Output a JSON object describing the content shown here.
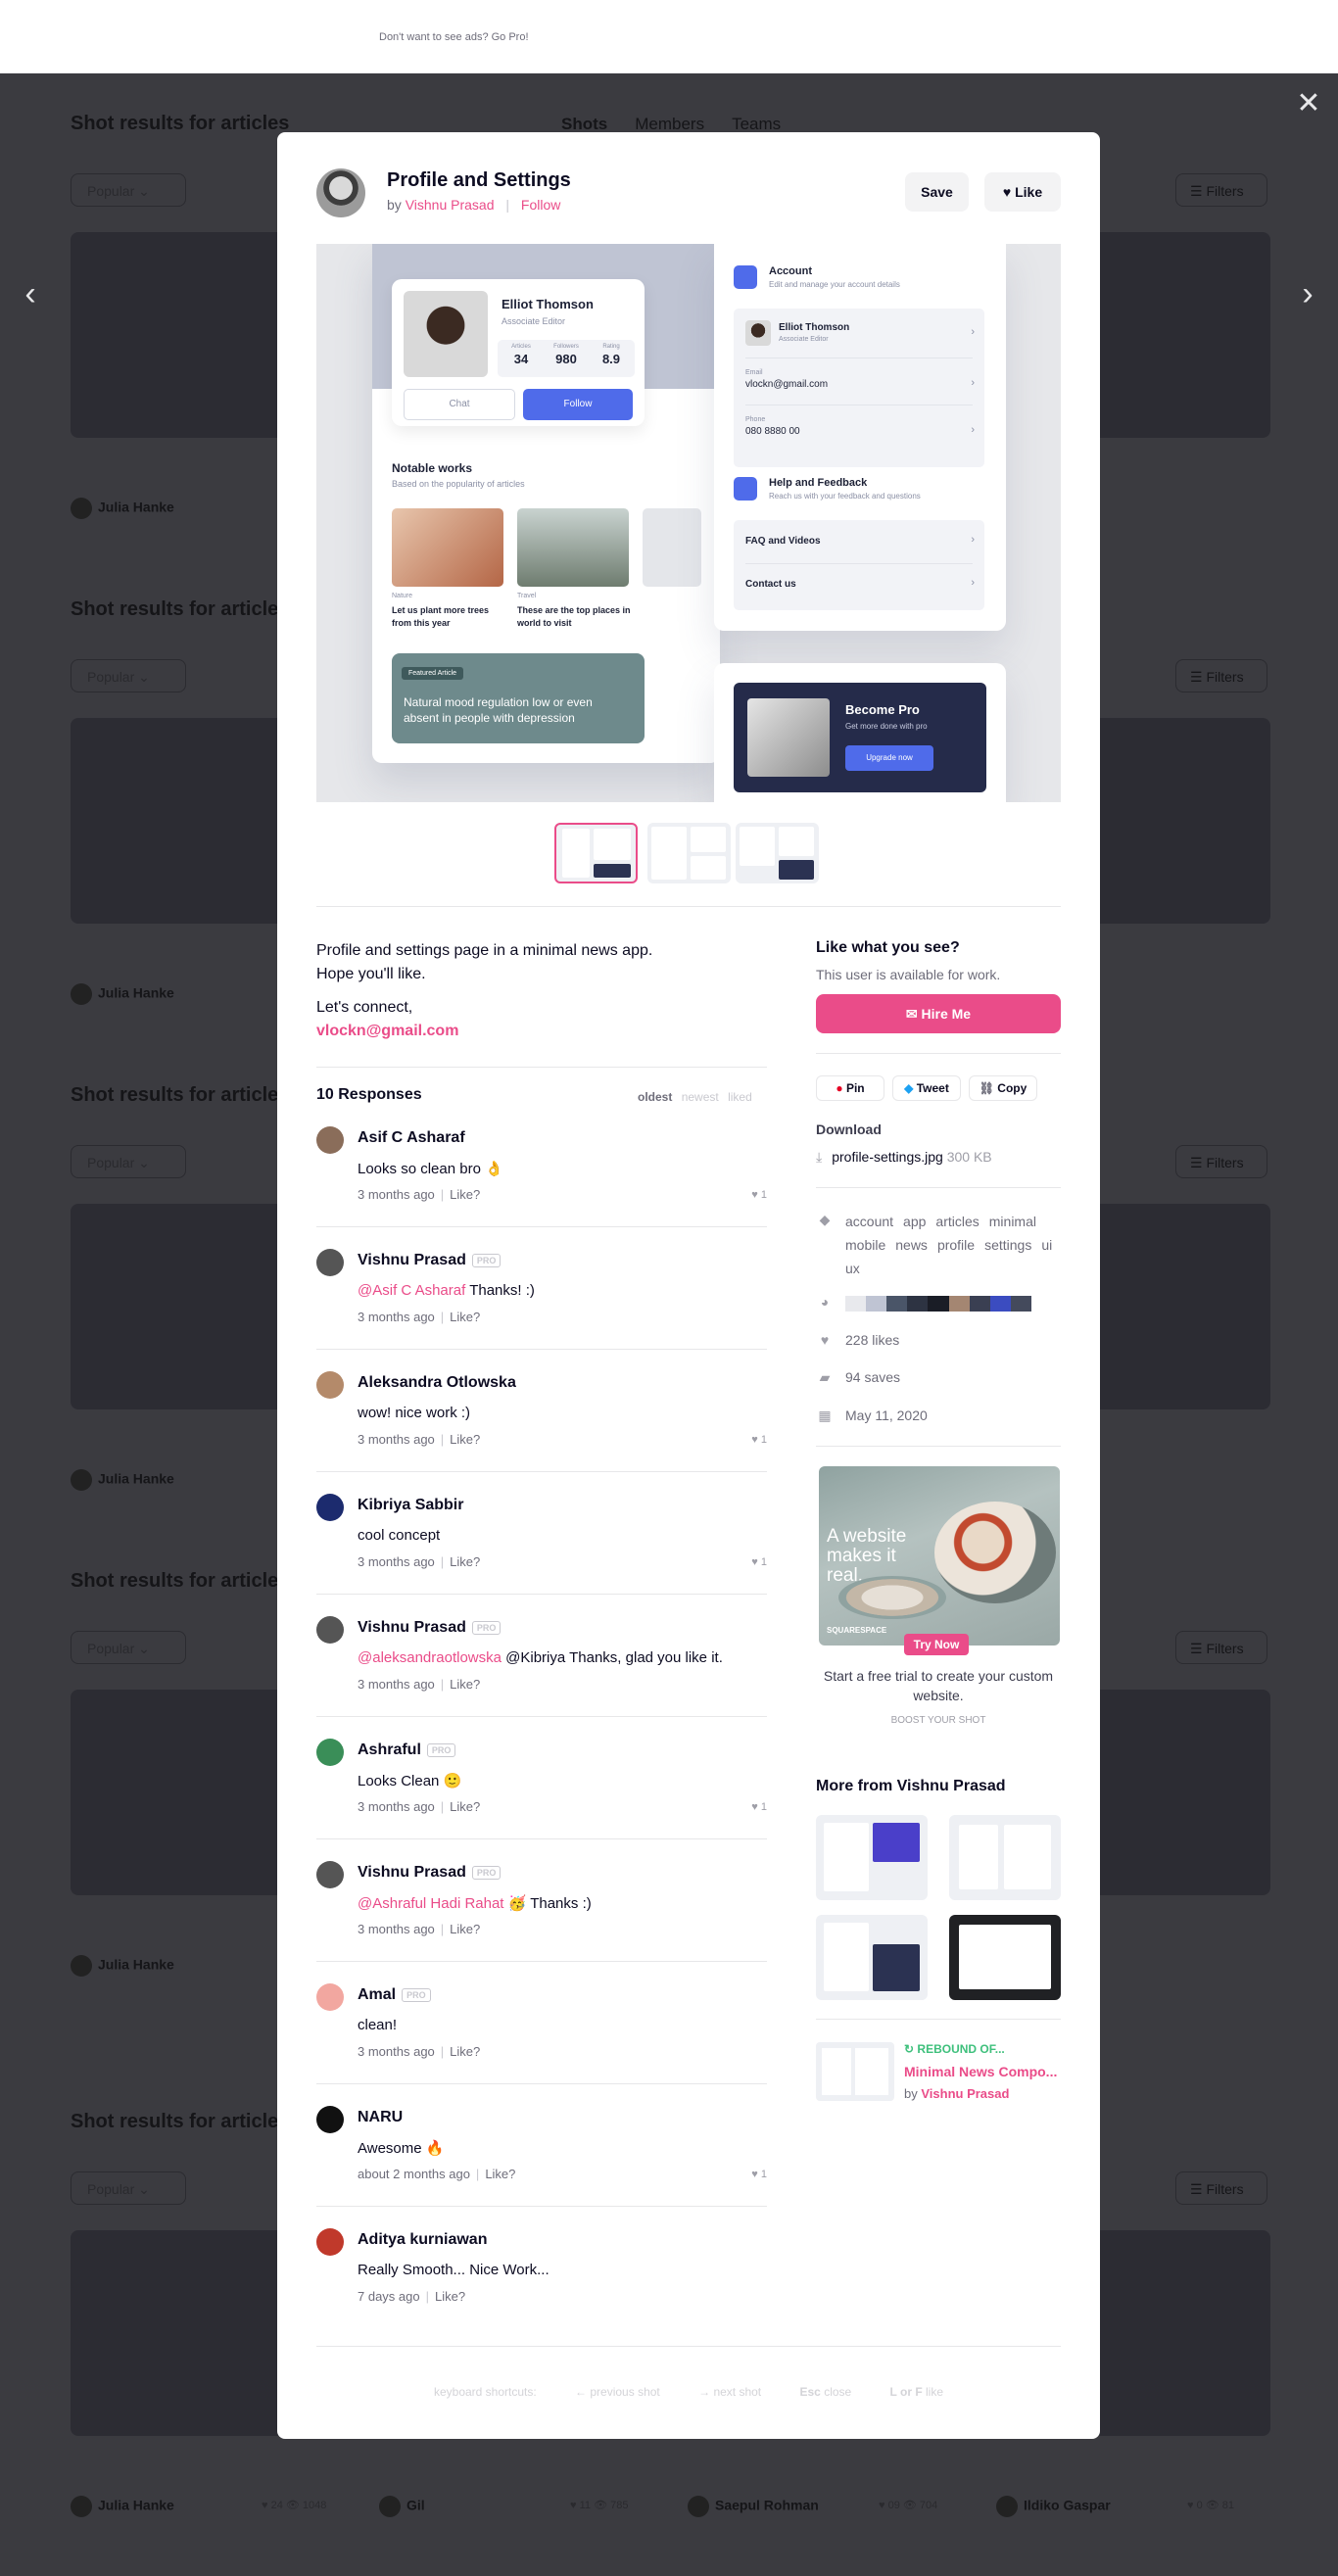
{
  "ad_bar": {
    "text": "Don't want to see ads? Go Pro!"
  },
  "background": {
    "section_title": "Shot results for articles",
    "tabs": [
      "Shots",
      "Members",
      "Teams"
    ],
    "filter_popular": "Popular",
    "filters": "Filters",
    "card_authors": [
      "Julia Hanke",
      "Gil",
      "Saepul Rohman",
      "Ildiko Gaspar"
    ],
    "card_stats": [
      "24",
      "1048",
      "11",
      "785",
      "09",
      "704",
      "0",
      "81"
    ]
  },
  "modal": {
    "title": "Profile and Settings",
    "by_prefix": "by",
    "author": "Vishnu Prasad",
    "follow": "Follow",
    "save": "Save",
    "like": "Like",
    "shot": {
      "profile_name": "Elliot Thomson",
      "profile_role": "Associate Editor",
      "stats": [
        {
          "label": "Articles",
          "value": "34"
        },
        {
          "label": "Followers",
          "value": "980"
        },
        {
          "label": "Rating",
          "value": "8.9"
        }
      ],
      "chat": "Chat",
      "follow": "Follow",
      "notable_title": "Notable works",
      "notable_sub": "Based on the popularity of articles",
      "works": [
        {
          "category": "Nature",
          "text": "Let us plant more trees from this year"
        },
        {
          "category": "Travel",
          "text": "These are the top places in world to visit"
        }
      ],
      "featured_tag": "Featured Article",
      "featured_text": "Natural mood regulation low or even absent in people with depression",
      "account_title": "Account",
      "account_sub": "Edit and manage your account details",
      "account_name": "Elliot Thomson",
      "account_role": "Associate Editor",
      "email_label": "Email",
      "email_value": "vlockn@gmail.com",
      "phone_label": "Phone",
      "phone_value": "080 8880 00",
      "help_title": "Help and Feedback",
      "help_sub": "Reach us with your feedback and questions",
      "faq": "FAQ and Videos",
      "contact": "Contact us",
      "pro_title": "Become Pro",
      "pro_sub": "Get more done with pro",
      "pro_button": "Upgrade now"
    },
    "description": {
      "line1": "Profile and settings page in a minimal news app.",
      "line2": "Hope you'll like.",
      "line3": "Let's connect,",
      "email": "vlockn@gmail.com"
    },
    "responses": {
      "title": "10 Responses",
      "sort": [
        "oldest",
        "newest",
        "liked"
      ],
      "pro_badge": "PRO",
      "like_link": "Like?",
      "items": [
        {
          "name": "Asif C Asharaf",
          "pro": false,
          "mention": "",
          "text": "Looks so clean bro 👌",
          "time": "3 months ago",
          "likes": "1",
          "avatar_color": "#8a6d5a"
        },
        {
          "name": "Vishnu Prasad",
          "pro": true,
          "mention": "@Asif C Asharaf",
          "text": "Thanks! :)",
          "time": "3 months ago",
          "likes": "",
          "avatar_color": "#555555"
        },
        {
          "name": "Aleksandra Otlowska",
          "pro": false,
          "mention": "",
          "text": "wow! nice work :)",
          "time": "3 months ago",
          "likes": "1",
          "avatar_color": "#b48a6a"
        },
        {
          "name": "Kibriya Sabbir",
          "pro": false,
          "mention": "",
          "text": "cool concept",
          "time": "3 months ago",
          "likes": "1",
          "avatar_color": "#1c2b6e"
        },
        {
          "name": "Vishnu Prasad",
          "pro": true,
          "mention": "@aleksandraotlowska",
          "text": "@Kibriya Thanks, glad you like it.",
          "time": "3 months ago",
          "likes": "",
          "avatar_color": "#555555"
        },
        {
          "name": "Ashraful",
          "pro": true,
          "mention": "",
          "text": "Looks Clean 🙂",
          "time": "3 months ago",
          "likes": "1",
          "avatar_color": "#3a8e58"
        },
        {
          "name": "Vishnu Prasad",
          "pro": true,
          "mention": "@Ashraful Hadi Rahat",
          "text": "🥳 Thanks :)",
          "time": "3 months ago",
          "likes": "",
          "avatar_color": "#555555"
        },
        {
          "name": "Amal",
          "pro": true,
          "mention": "",
          "text": "clean!",
          "time": "3 months ago",
          "likes": "",
          "avatar_color": "#f2a7a0"
        },
        {
          "name": "NARU",
          "pro": false,
          "mention": "",
          "text": "Awesome 🔥",
          "time": "about 2 months ago",
          "likes": "1",
          "avatar_color": "#111111"
        },
        {
          "name": "Aditya kurniawan",
          "pro": false,
          "mention": "",
          "text": "Really Smooth... Nice Work...",
          "time": "7 days ago",
          "likes": "",
          "avatar_color": "#c0392b"
        }
      ]
    },
    "sidebar": {
      "like_title": "Like what you see?",
      "like_sub": "This user is available for work.",
      "hire": "✉ Hire Me",
      "share": [
        "Pin",
        "Tweet",
        "Copy"
      ],
      "download_title": "Download",
      "file_name": "profile-settings.jpg",
      "file_size": "300 KB",
      "tags": [
        "account",
        "app",
        "articles",
        "minimal",
        "mobile",
        "news",
        "profile",
        "settings",
        "ui",
        "ux"
      ],
      "colors": [
        "#e8e9ed",
        "#bfc4d3",
        "#4a5568",
        "#2d3342",
        "#1a1d26",
        "#a48672",
        "#3a3f52",
        "#3b4cc0",
        "#444a5c"
      ],
      "likes": "228 likes",
      "saves": "94 saves",
      "date": "May 11, 2020",
      "ad_headline": "A website makes it real.",
      "ad_brand": "SQUARESPACE",
      "ad_try": "Try Now",
      "ad_copy": "Start a free trial to create your custom website.",
      "boost": "BOOST YOUR SHOT",
      "more_title": "More from Vishnu Prasad",
      "rebound_label": "REBOUND OF...",
      "rebound_title": "Minimal News Compo...",
      "rebound_by_prefix": "by",
      "rebound_author": "Vishnu Prasad"
    },
    "shortcuts": {
      "keyboard": "keyboard shortcuts:",
      "prev_key": "←",
      "prev": "previous shot",
      "next_key": "→",
      "next": "next shot",
      "esc_key": "Esc",
      "close": "close",
      "like_keys": "L or F",
      "like": "like"
    }
  }
}
